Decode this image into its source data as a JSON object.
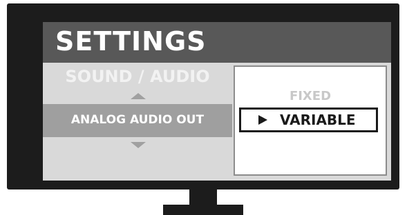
{
  "settings": {
    "title": "SETTINGS"
  },
  "menu": {
    "category": "SOUND / AUDIO",
    "selected_item": "ANALOG AUDIO OUT"
  },
  "options": {
    "items": [
      {
        "label": "FIXED",
        "selected": false
      },
      {
        "label": "VARIABLE",
        "selected": true
      }
    ]
  },
  "colors": {
    "title_bar": "#585858",
    "screen_bg": "#d9d9d9",
    "selected_row": "#9f9f9f",
    "bezel": "#1c1c1c",
    "option_panel": "#ffffff"
  },
  "icons": {
    "up": "up-arrow-icon",
    "down": "down-arrow-icon",
    "cursor": "play-icon"
  }
}
